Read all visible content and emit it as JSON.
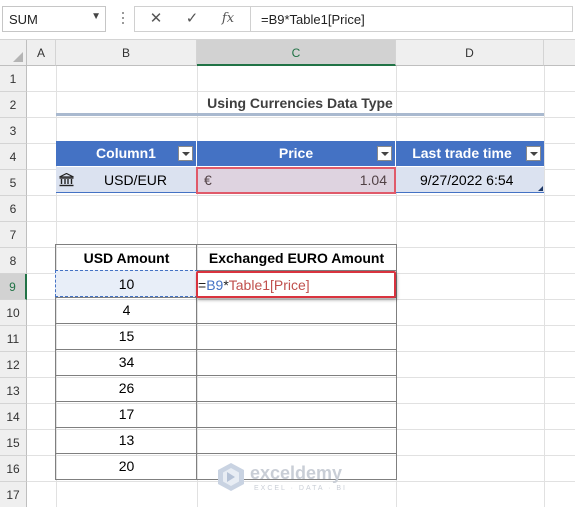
{
  "formula_bar": {
    "name_box": "SUM",
    "cancel_glyph": "✕",
    "enter_glyph": "✓",
    "function_glyph": "fx",
    "formula": "=B9*Table1[Price]"
  },
  "columns": [
    "A",
    "B",
    "C",
    "D"
  ],
  "selected_column": "C",
  "rows": [
    "1",
    "2",
    "3",
    "4",
    "5",
    "6",
    "7",
    "8",
    "9",
    "10",
    "11",
    "12",
    "13",
    "14",
    "15",
    "16",
    "17"
  ],
  "selected_row": "9",
  "title": "Using Currencies Data Type",
  "table1": {
    "headers": [
      "Column1",
      "Price",
      "Last trade time"
    ],
    "row": {
      "icon": "bank-icon",
      "currency_pair": "USD/EUR",
      "currency_symbol": "€",
      "price": "1.04",
      "last_trade_time": "9/27/2022 6:54"
    }
  },
  "table2": {
    "headers": [
      "USD Amount",
      "Exchanged EURO Amount"
    ],
    "usd_amounts": [
      "10",
      "4",
      "15",
      "34",
      "26",
      "17",
      "13",
      "20"
    ],
    "editing_formula": {
      "eq": "=",
      "ref1": "B9",
      "op": "*",
      "ref2": "Table1[Price]"
    }
  },
  "colors": {
    "header_blue": "#4472c4",
    "ref_blue": "#4472c4",
    "ref_red": "#c0504d",
    "edit_border": "#d9333f"
  },
  "watermark": {
    "name": "exceldemy",
    "tagline": "EXCEL · DATA · BI"
  }
}
